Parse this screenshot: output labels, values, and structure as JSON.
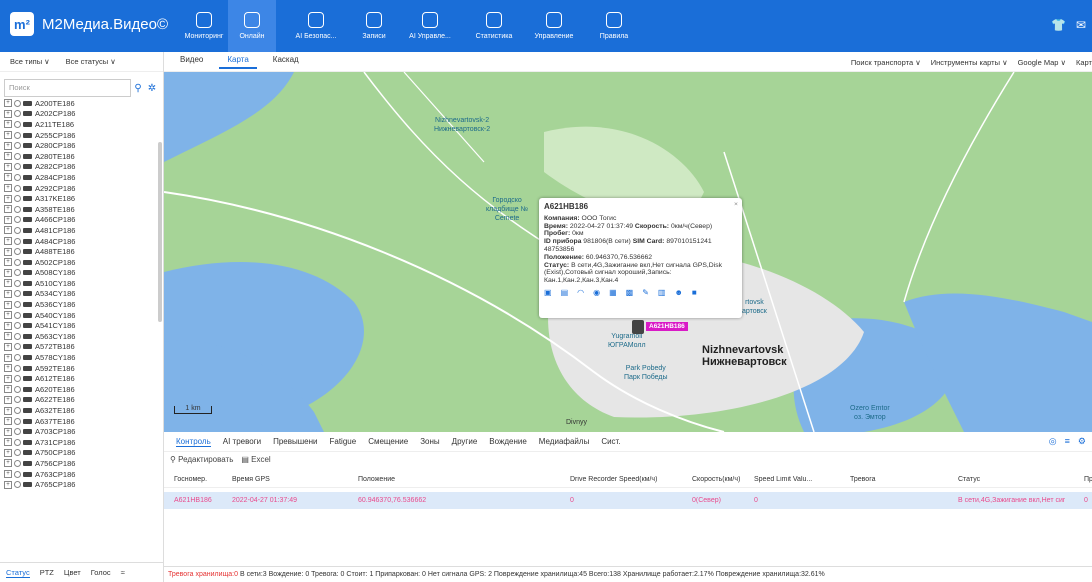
{
  "app": {
    "title": "M2Медиа.Видео©",
    "logo_mark": "m²"
  },
  "nav": [
    {
      "label": "Мониторинг",
      "icon": "shield-icon"
    },
    {
      "label": "Онлайн",
      "icon": "location-pin-icon",
      "active": true
    },
    {
      "label": "AI Безопас...",
      "icon": "check-shield-icon"
    },
    {
      "label": "Записи",
      "icon": "record-icon"
    },
    {
      "label": "AI Управле...",
      "icon": "play-icon"
    },
    {
      "label": "Статистика",
      "icon": "chart-icon"
    },
    {
      "label": "Управление",
      "icon": "list-icon"
    },
    {
      "label": "Правила",
      "icon": "window-icon"
    }
  ],
  "left": {
    "type_filter": "Все типы ∨",
    "status_filter": "Все статусы ∨",
    "search_placeholder": "Поиск",
    "vehicles": [
      "A200TE186",
      "A202CP186",
      "A211TE186",
      "A255CP186",
      "A280CP186",
      "A280TE186",
      "A282CP186",
      "A284CP186",
      "A292CP186",
      "A317KE186",
      "A358TE186",
      "A466CP186",
      "A481CP186",
      "A484CP186",
      "A488TE186",
      "A502CP186",
      "A508CY186",
      "A510CY186",
      "A534CY186",
      "A536CY186",
      "A540CY186",
      "A541CY186",
      "A563CY186",
      "A572TB186",
      "A578CY186",
      "A592TE186",
      "A612TE186",
      "A620TE186",
      "A622TE186",
      "A632TE186",
      "A637TE186",
      "A703CP186",
      "A731CP186",
      "A750CP186",
      "A756CP186",
      "A763CP186",
      "A765CP186"
    ],
    "bottom_tabs": [
      "Статус",
      "PTZ",
      "Цвет",
      "Голос",
      "≈"
    ]
  },
  "main_tabs": [
    {
      "label": "Видео"
    },
    {
      "label": "Карта",
      "active": true
    },
    {
      "label": "Каскад"
    }
  ],
  "map_tools": [
    "Поиск транспорта ∨",
    "Инструменты карты ∨",
    "Google Map ∨",
    "Карт"
  ],
  "map": {
    "poi": [
      {
        "text": "Nizhnevartovsk-2\nНижневартовск-2"
      },
      {
        "text": "Городско\nкладбище №\nCemete"
      },
      {
        "text": "Yugramoll\nЮГРАМолл"
      },
      {
        "text": "Park Pobedy\nПарк Победы"
      },
      {
        "text": "Ozero Emtor\nоз. Эмтор"
      },
      {
        "text": "Divnyy"
      },
      {
        "text": "rtovsk\nартовск"
      }
    ],
    "city": "Nizhnevartovsk\nНижневартовск",
    "scale": "1 km",
    "marker_label": "A621HB186",
    "popup": {
      "title": "A621HB186",
      "company_label": "Компания:",
      "company": "ООО Тогис",
      "time_label": "Время:",
      "time": "2022-04-27 01:37:49",
      "speed_label": "Скорость:",
      "speed": "0км/ч(Север)",
      "mileage_label": "Пробег:",
      "mileage": "0км",
      "device_label": "ID прибора",
      "device": "981806(В сети)",
      "sim_label": "SIM Card:",
      "sim": "897010151241 48753856",
      "position_label": "Положение:",
      "position": "60.946370,76.536662",
      "status_label": "Статус:",
      "status": "В сети,4G,Зажигание вкл,Нет сигнала GPS,Disk (Exist),Сотовый сигнал хороший,Запись: Кан.1,Кан.2,Кан.3,Кан.4"
    }
  },
  "bottom_tabs": [
    {
      "label": "Контроль",
      "active": true
    },
    {
      "label": "AI тревоги"
    },
    {
      "label": "Превышени"
    },
    {
      "label": "Fatigue"
    },
    {
      "label": "Смещение"
    },
    {
      "label": "Зоны"
    },
    {
      "label": "Другие"
    },
    {
      "label": "Вождение"
    },
    {
      "label": "Медиафайлы"
    },
    {
      "label": "Сист."
    }
  ],
  "actions": {
    "edit": "Редактировать",
    "excel": "Excel"
  },
  "table": {
    "headers": [
      "Госномер.",
      "Время GPS",
      "Положение",
      "Drive Recorder Speed(км/ч)",
      "Скорость(км/ч)",
      "Speed Limit Valu...",
      "Тревога",
      "Статус",
      "Пробе"
    ],
    "row": [
      "A621HB186",
      "2022-04-27 01:37:49",
      "60.946370,76.536662",
      "0",
      "0(Север)",
      "0",
      "",
      "В сети,4G,Зажигание вкл,Нет сиг",
      "0"
    ]
  },
  "status_bar": {
    "alarm": "Тревога хранилища:0",
    "rest": "В сети:3  Вождение: 0  Тревога: 0  Стоит: 1  Припаркован: 0  Нет сигнала GPS: 2  Повреждение хранилища:45  Всего:138  Хранилище работает:2.17%  Повреждение хранилища:32.61%"
  }
}
